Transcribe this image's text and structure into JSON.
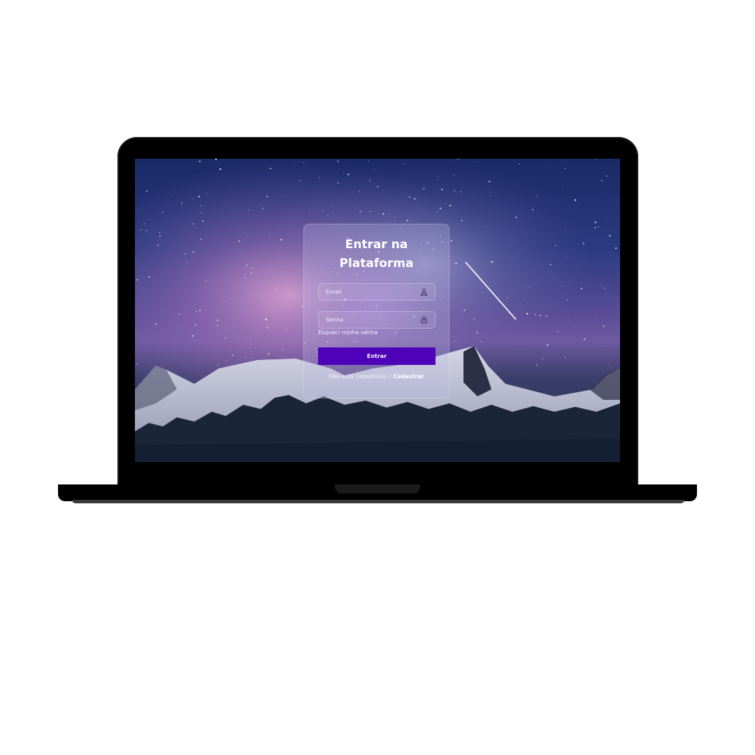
{
  "login": {
    "title_line1": "Entrar na",
    "title_line2": "Plataforma",
    "email_placeholder": "Email",
    "password_placeholder": "Senha",
    "forgot_password": "Esqueci minha senha",
    "submit_label": "Entrar",
    "not_registered": "Não está cadastrado ?",
    "register_link": "Cadastrar"
  },
  "icons": {
    "email_field": "user-icon",
    "password_field": "lock-icon"
  },
  "colors": {
    "primary_button": "#4f00b9",
    "background_sky": "#1a2a66",
    "text": "#ffffff"
  }
}
